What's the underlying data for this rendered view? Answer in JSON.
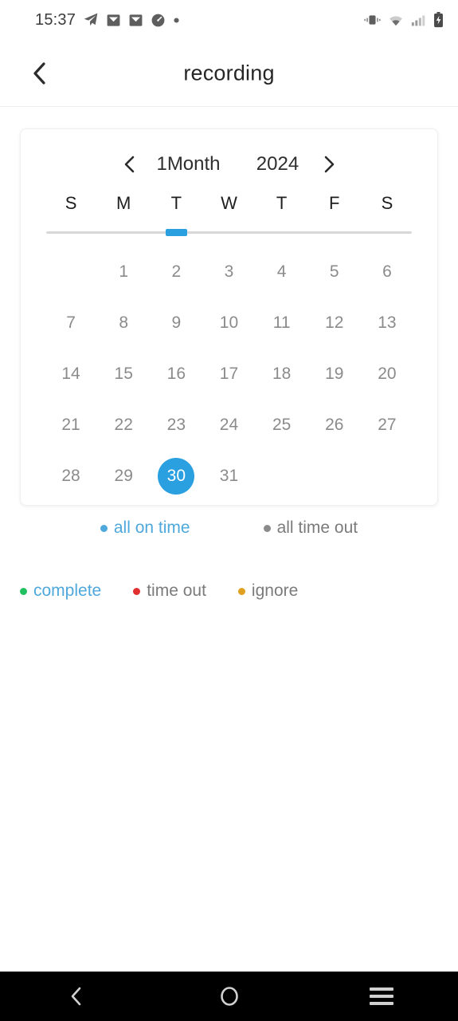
{
  "status_bar": {
    "time": "15:37",
    "left_icons": [
      "telegram-send-icon",
      "mail-icon",
      "mail-icon",
      "clock-icon",
      "dot-icon"
    ],
    "right_icons": [
      "vibrate-icon",
      "wifi-icon",
      "signal-icon",
      "battery-charging-icon"
    ]
  },
  "app_bar": {
    "back_icon": "chevron-left-icon",
    "title": "recording"
  },
  "calendar": {
    "prev_icon": "chevron-left-icon",
    "next_icon": "chevron-right-icon",
    "month_label": "1Month",
    "year_label": "2024",
    "weekdays": [
      "S",
      "M",
      "T",
      "W",
      "T",
      "F",
      "S"
    ],
    "leading_blanks": 1,
    "days": [
      "1",
      "2",
      "3",
      "4",
      "5",
      "6",
      "7",
      "8",
      "9",
      "10",
      "11",
      "12",
      "13",
      "14",
      "15",
      "16",
      "17",
      "18",
      "19",
      "20",
      "21",
      "22",
      "23",
      "24",
      "25",
      "26",
      "27",
      "28",
      "29",
      "30",
      "31"
    ],
    "selected_day": "30",
    "selected_weekday_index": 2,
    "accent_color": "#2ba0e0",
    "day_text_color": "#8b8b8b",
    "selected_text_color": "#ffffff"
  },
  "filters": [
    {
      "label": "all on time",
      "dot_color": "#4fa8dc",
      "text_color": "#4fa8dc",
      "active": true
    },
    {
      "label": "all time out",
      "dot_color": "#8b8b8b",
      "text_color": "#7b7b7b",
      "active": false
    }
  ],
  "legend": [
    {
      "label": "complete",
      "dot_color": "#20c060",
      "text_color": "#4fa8dc"
    },
    {
      "label": "time out",
      "dot_color": "#e03030",
      "text_color": "#7b7b7b"
    },
    {
      "label": "ignore",
      "dot_color": "#e0a020",
      "text_color": "#7b7b7b"
    }
  ],
  "nav_bar": {
    "back_icon": "nav-back-icon",
    "home_icon": "nav-home-icon",
    "recents_icon": "nav-recents-icon"
  }
}
